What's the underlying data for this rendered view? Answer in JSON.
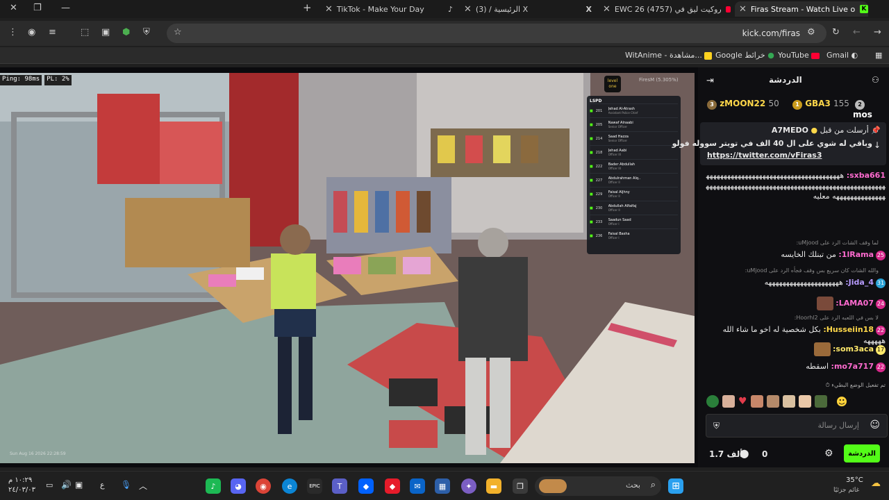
{
  "browser": {
    "tabs": [
      {
        "title": "Firas Stream - Watch Live o",
        "icon": "kick-icon",
        "active": true
      },
      {
        "title": "EWC 26 (4757) روكيت ليق في",
        "icon": "youtube-icon",
        "active": false
      },
      {
        "title": "الرئيسية / (3) X",
        "icon": "x-icon",
        "active": false
      },
      {
        "title": "TikTok - Make Your Day",
        "icon": "tiktok-icon",
        "active": false
      }
    ],
    "new_tab": "+",
    "url": "kick.com/firas",
    "bookmarks": [
      "Gmail",
      "YouTube",
      "Google خرائط",
      "WitAnime - مشاهدة..."
    ]
  },
  "stream": {
    "ping": "Ping: 98ms",
    "pl": "PL: 2%",
    "overlay_brand": "level one",
    "overlay_user": "FiresM (5.305%)",
    "timestamp": "Sun Aug 16 2026 22:28:59",
    "lspd": {
      "header": "LSPD",
      "rows": [
        {
          "id": "201",
          "name": "Jehad Al-Atrash",
          "rank": "Assistant Police Chief"
        },
        {
          "id": "205",
          "name": "Nawaf Alnaabi",
          "rank": "Senior Officer"
        },
        {
          "id": "214",
          "name": "Saad Hazza",
          "rank": "Senior Officer"
        },
        {
          "id": "218",
          "name": "Jehad Aabi",
          "rank": "Officer III"
        },
        {
          "id": "222",
          "name": "Bader Abdullah",
          "rank": "Officer III"
        },
        {
          "id": "227",
          "name": "Abdulrahman Alq..",
          "rank": "Officer II"
        },
        {
          "id": "229",
          "name": "Faisal Aljhny",
          "rank": "Officer II"
        },
        {
          "id": "230",
          "name": "Abdullah Alfaifaj",
          "rank": "Officer II"
        },
        {
          "id": "233",
          "name": "Saadun Saad",
          "rank": "Officer I"
        },
        {
          "id": "236",
          "name": "Faisal Basha",
          "rank": "Officer I"
        }
      ]
    }
  },
  "chat": {
    "title": "الدردشة",
    "leaders": [
      {
        "rank": "3",
        "name": "zMOON22",
        "count": "50"
      },
      {
        "rank": "1",
        "name": "GBA3",
        "count": "155"
      },
      {
        "rank": "2",
        "name": "mos",
        "count": ""
      }
    ],
    "pinned": {
      "label": "أرسلت من قبل",
      "user": "A7MEDO",
      "text": "وباقي له شوي على ال 40 الف في تويتر سووله فولو",
      "link": "https://twitter.com/vFiras3"
    },
    "messages": [
      {
        "user": "sxba661:",
        "text": "ههههههههههههههههههههههههههههههههههههههههههههههههههههههههههههههههههههههههههههههههههههههههههههههههههههههههه معليه",
        "color": "#ff6bd0"
      },
      {
        "reply": "لما وقف الشات الرد على uMjood:",
        "user": "1lRama:",
        "text": "من تبنلك الخايسه",
        "badge": "25",
        "color": "#ff6bd0"
      },
      {
        "reply": "والله الشات كان سريع بس وقف فجأه الرد على uMjood:",
        "user": "Jida_4:",
        "text": "هههههههههههههههههههههه",
        "badge": "31",
        "color": "#b89cff"
      },
      {
        "user": "LAMA07:",
        "text": "",
        "badge": "24",
        "color": "#ff6bd0"
      },
      {
        "reply": "لا بس في اللعبه الرد على Hoorhl2:",
        "user": "Husseiin18:",
        "text": "بكل شخصية له اخو ما شاء الله هههههه",
        "badge": "22",
        "color": "#ffd84a"
      },
      {
        "user": "som3aca:",
        "text": "",
        "badge": "17",
        "color": "#ffe96b"
      },
      {
        "user": "mo7a717:",
        "text": "اسقطه",
        "badge": "22",
        "color": "#ff6bd0"
      }
    ],
    "slow_mode": "تم تفعيل الوضع البطيء",
    "input_placeholder": "إرسال رسالة",
    "viewers": "1.7 ألف",
    "points": "0",
    "chat_button": "الدردشة"
  },
  "taskbar": {
    "search_placeholder": "بحث",
    "weather_temp": "35°C",
    "weather_text": "غائم جزئيًا",
    "time": "١٠:٢٩ م",
    "date": "٢٤/٠٣/٠٣",
    "lang": "ع"
  },
  "colors": {
    "kick_green": "#53fc18",
    "chat_bg": "#0f0f12",
    "pink": "#ff6bd0"
  }
}
